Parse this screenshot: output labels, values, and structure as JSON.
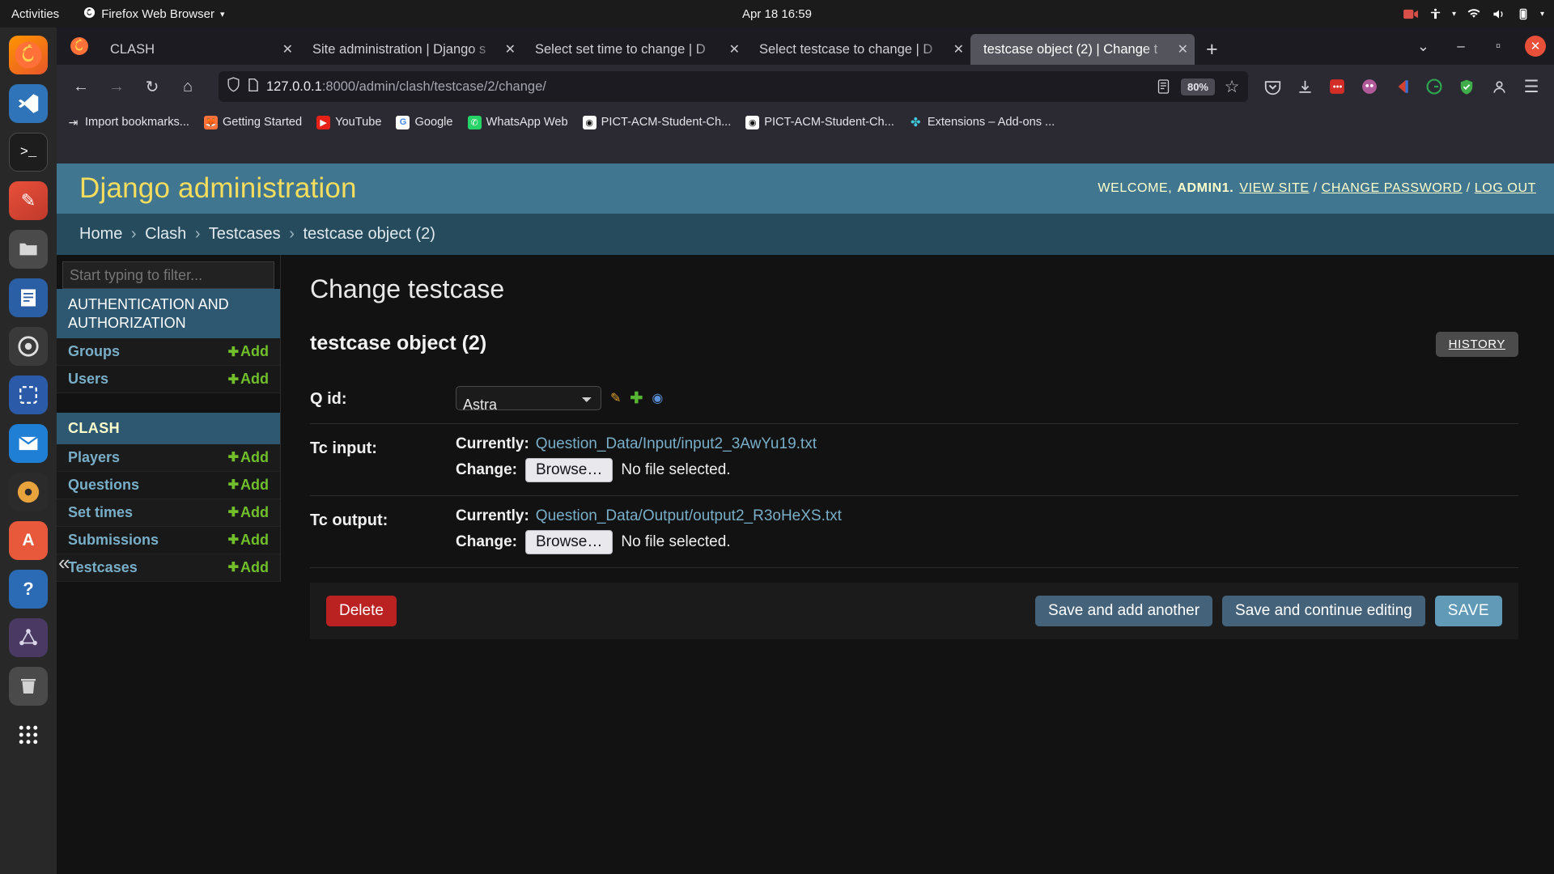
{
  "desktop": {
    "activities": "Activities",
    "app_menu": "Firefox Web Browser",
    "clock": "Apr 18  16:59",
    "dock_items": [
      {
        "name": "firefox",
        "glyph": "🦊"
      },
      {
        "name": "vscode",
        "glyph": "⎘"
      },
      {
        "name": "terminal",
        "glyph": "⌨"
      },
      {
        "name": "pencil-app",
        "glyph": "✎"
      },
      {
        "name": "files",
        "glyph": "🗁"
      },
      {
        "name": "libreoffice-writer",
        "glyph": "📄"
      },
      {
        "name": "settings",
        "glyph": "⚙"
      },
      {
        "name": "screenshot",
        "glyph": "❑"
      },
      {
        "name": "thunderbird",
        "glyph": "✉"
      },
      {
        "name": "rhythmbox",
        "glyph": "◉"
      },
      {
        "name": "ubuntu-software",
        "glyph": "A"
      },
      {
        "name": "help",
        "glyph": "?"
      },
      {
        "name": "network-app",
        "glyph": "⁂"
      },
      {
        "name": "trash",
        "glyph": "🗑"
      },
      {
        "name": "show-applications",
        "glyph": "∷"
      }
    ],
    "dock_collapse": "«"
  },
  "browser": {
    "tabs": [
      {
        "title": "CLASH",
        "active": false
      },
      {
        "title": "Site administration | Django s",
        "active": false
      },
      {
        "title": "Select set time to change | D",
        "active": false
      },
      {
        "title": "Select testcase to change | D",
        "active": false
      },
      {
        "title": "testcase object (2) | Change t",
        "active": true
      }
    ],
    "new_tab_label": "+",
    "tab_list_chevron": "⌄",
    "window_minimize": "–",
    "window_maximize": "▫",
    "window_close": "✕",
    "nav": {
      "back": "←",
      "forward": "→",
      "reload": "↻",
      "home": "⌂"
    },
    "url": {
      "host": "127.0.0.1",
      "path": ":8000/admin/clash/testcase/2/change/",
      "reader_icon": "reader-view-icon",
      "zoom": "80%",
      "bookmark_star": "☆"
    },
    "toolbar_icons": [
      {
        "name": "pocket-icon",
        "glyph": "▽"
      },
      {
        "name": "downloads-icon",
        "glyph": "⬇"
      },
      {
        "name": "lastpass-icon",
        "glyph": "■"
      },
      {
        "name": "adblock-icon",
        "glyph": "●"
      },
      {
        "name": "extension-icon",
        "glyph": "◀"
      },
      {
        "name": "grammarly-icon",
        "glyph": "G"
      },
      {
        "name": "shield-extension-icon",
        "glyph": "✔"
      },
      {
        "name": "account-icon",
        "glyph": "○"
      },
      {
        "name": "menu-icon",
        "glyph": "☰"
      }
    ],
    "bookmarks": [
      {
        "label": "Import bookmarks...",
        "icon": "import-icon"
      },
      {
        "label": "Getting Started",
        "icon": "firefox-icon"
      },
      {
        "label": "YouTube",
        "icon": "youtube-icon"
      },
      {
        "label": "Google",
        "icon": "google-icon"
      },
      {
        "label": "WhatsApp Web",
        "icon": "whatsapp-icon"
      },
      {
        "label": "PICT-ACM-Student-Ch...",
        "icon": "github-icon"
      },
      {
        "label": "PICT-ACM-Student-Ch...",
        "icon": "github-icon"
      },
      {
        "label": "Extensions – Add-ons ...",
        "icon": "addons-icon"
      }
    ]
  },
  "django": {
    "brand": "Django administration",
    "welcome_prefix": "WELCOME,",
    "username": "ADMIN1.",
    "view_site": "VIEW SITE",
    "change_password": "CHANGE PASSWORD",
    "log_out": "LOG OUT",
    "breadcrumbs": [
      "Home",
      "Clash",
      "Testcases",
      "testcase object (2)"
    ],
    "sidebar": {
      "filter_placeholder": "Start typing to filter...",
      "groups": [
        {
          "caption": "AUTHENTICATION AND AUTHORIZATION",
          "models": [
            {
              "name": "Groups",
              "add": "Add"
            },
            {
              "name": "Users",
              "add": "Add"
            }
          ]
        },
        {
          "caption": "CLASH",
          "models": [
            {
              "name": "Players",
              "add": "Add"
            },
            {
              "name": "Questions",
              "add": "Add"
            },
            {
              "name": "Set times",
              "add": "Add"
            },
            {
              "name": "Submissions",
              "add": "Add"
            },
            {
              "name": "Testcases",
              "add": "Add"
            }
          ]
        }
      ]
    },
    "main": {
      "page_title": "Change testcase",
      "object_title": "testcase object (2)",
      "history_button": "HISTORY",
      "fields": {
        "qid": {
          "label": "Q id:",
          "selected": "Astra",
          "related_icons": [
            {
              "name": "change-related-icon",
              "glyph": "✎"
            },
            {
              "name": "add-related-icon",
              "glyph": "✚"
            },
            {
              "name": "view-related-icon",
              "glyph": "◉"
            }
          ]
        },
        "tc_input": {
          "label": "Tc input:",
          "currently_label": "Currently:",
          "currently_value": "Question_Data/Input/input2_3AwYu19.txt",
          "change_label": "Change:",
          "browse_button": "Browse…",
          "no_file": "No file selected."
        },
        "tc_output": {
          "label": "Tc output:",
          "currently_label": "Currently:",
          "currently_value": "Question_Data/Output/output2_R3oHeXS.txt",
          "change_label": "Change:",
          "browse_button": "Browse…",
          "no_file": "No file selected."
        }
      },
      "buttons": {
        "delete": "Delete",
        "save_add_another": "Save and add another",
        "save_continue": "Save and continue editing",
        "save": "SAVE"
      }
    }
  },
  "colors": {
    "django_header": "#417690",
    "breadcrumb": "#264b5d",
    "link_blue": "#79aec8",
    "accent_yellow": "#f5dd5d",
    "add_green": "#70bf2b",
    "delete_red": "#ba2121",
    "save_blue": "#609ab6"
  }
}
